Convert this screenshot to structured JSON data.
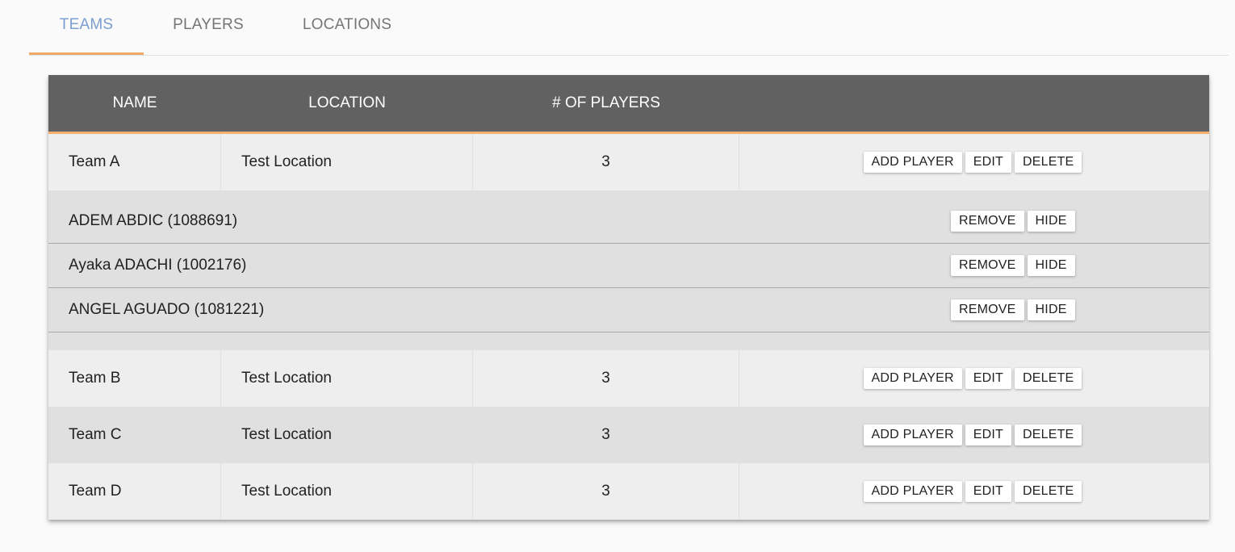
{
  "tabs": [
    {
      "label": "TEAMS",
      "active": true
    },
    {
      "label": "PLAYERS",
      "active": false
    },
    {
      "label": "LOCATIONS",
      "active": false
    }
  ],
  "colors": {
    "accent_orange": "#f6b06e",
    "tab_active_blue": "#7b9fd1",
    "header_bg": "#616161"
  },
  "table": {
    "headers": [
      "NAME",
      "LOCATION",
      "# OF PLAYERS",
      ""
    ],
    "team_actions": {
      "add_player": "ADD PLAYER",
      "edit": "EDIT",
      "delete": "DELETE"
    },
    "player_actions": {
      "remove": "REMOVE",
      "hide": "HIDE"
    },
    "teams": [
      {
        "name": "Team A",
        "location": "Test Location",
        "players_count": "3",
        "expanded": true,
        "players": [
          "ADEM ABDIC (1088691)",
          "Ayaka ADACHI (1002176)",
          "ANGEL AGUADO (1081221)"
        ]
      },
      {
        "name": "Team B",
        "location": "Test Location",
        "players_count": "3"
      },
      {
        "name": "Team C",
        "location": "Test Location",
        "players_count": "3"
      },
      {
        "name": "Team D",
        "location": "Test Location",
        "players_count": "3"
      }
    ]
  }
}
